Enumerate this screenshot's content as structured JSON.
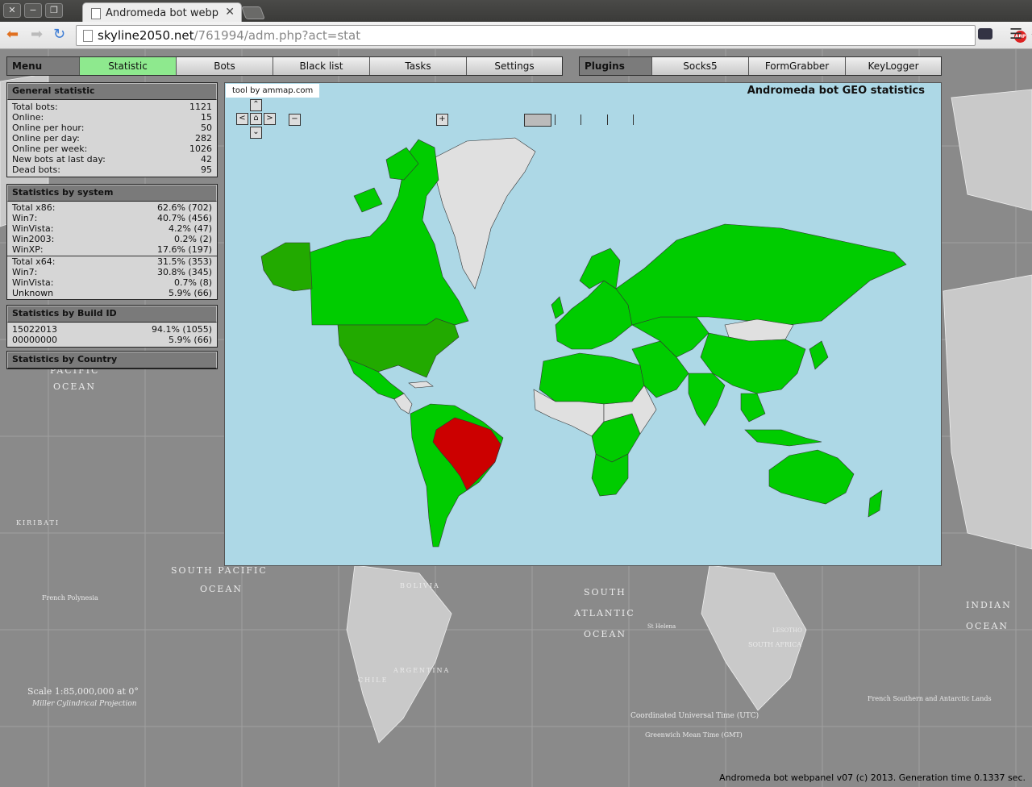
{
  "browser": {
    "tab_title": "Andromeda bot webpanel",
    "tab_close": "✕",
    "url_host": "skyline2050.net",
    "url_path": "/761994/adm.php?act=stat",
    "abp_badge": "ABP"
  },
  "nav": {
    "menu_label": "Menu",
    "items": [
      "Statistic",
      "Bots",
      "Black list",
      "Tasks",
      "Settings"
    ],
    "active": "Statistic",
    "plugins_label": "Plugins",
    "plugins": [
      "Socks5",
      "FormGrabber",
      "KeyLogger"
    ]
  },
  "general": {
    "title": "General statistic",
    "rows": [
      {
        "label": "Total bots:",
        "value": "1121"
      },
      {
        "label": "Online:",
        "value": "15"
      },
      {
        "label": "Online per hour:",
        "value": "50"
      },
      {
        "label": "Online per day:",
        "value": "282"
      },
      {
        "label": "Online per week:",
        "value": "1026"
      },
      {
        "label": "New bots at last day:",
        "value": "42"
      },
      {
        "label": "Dead bots:",
        "value": "95"
      }
    ]
  },
  "system": {
    "title": "Statistics by system",
    "rows": [
      {
        "label": "Total x86:",
        "value": "62.6% (702)"
      },
      {
        "label": "Win7:",
        "value": "40.7% (456)"
      },
      {
        "label": "WinVista:",
        "value": "4.2% (47)"
      },
      {
        "label": "Win2003:",
        "value": "0.2% (2)"
      },
      {
        "label": "WinXP:",
        "value": "17.6% (197)"
      },
      {
        "label": "Total x64:",
        "value": "31.5% (353)"
      },
      {
        "label": "Win7:",
        "value": "30.8% (345)"
      },
      {
        "label": "WinVista:",
        "value": "0.7% (8)"
      },
      {
        "label": "Unknown",
        "value": "5.9% (66)"
      }
    ]
  },
  "build": {
    "title": "Statistics by Build ID",
    "rows": [
      {
        "label": "15022013",
        "value": "94.1% (1055)"
      },
      {
        "label": "00000000",
        "value": "5.9% (66)"
      }
    ]
  },
  "country": {
    "title": "Statistics by Country"
  },
  "map": {
    "credit": "tool by ammap.com",
    "title": "Andromeda bot GEO statistics",
    "zoom_out": "−",
    "zoom_in": "+",
    "colors": {
      "ocean": "#add8e6",
      "bots": "#00cc00",
      "usa": "#22aa00",
      "top_country": "#cc0000",
      "none": "#e0e0e0"
    },
    "highlight_country": "Brazil"
  },
  "background_map": {
    "labels": [
      "PACIFIC",
      "OCEAN",
      "SOUTH PACIFIC",
      "OCEAN",
      "SOUTH",
      "ATLANTIC",
      "OCEAN",
      "INDIAN",
      "OCEAN",
      "KIRIBATI",
      "ARGENTINA",
      "CHILE",
      "BOLIVIA",
      "Scale 1:85,000,000 at 0°",
      "Miller Cylindrical Projection",
      "Coordinated Universal Time (UTC)",
      "Greenwich Mean Time (GMT)",
      "French Polynesia",
      "SOUTH AFRICA",
      "LESOTHO",
      "St Helena",
      "French Southern and Antarctic Lands"
    ]
  },
  "footer": "Andromeda bot webpanel v07 (c) 2013. Generation time 0.1337 sec."
}
